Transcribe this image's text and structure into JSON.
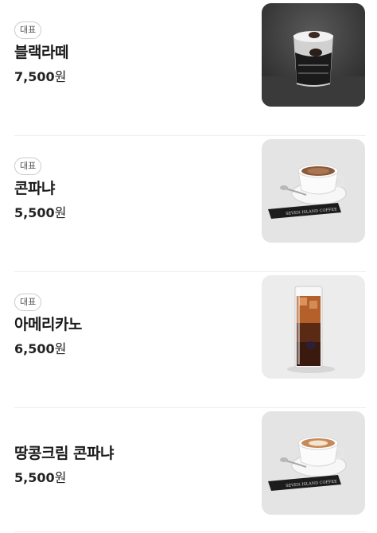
{
  "menu": {
    "items": [
      {
        "badge": "대표",
        "name": "블랙라떼",
        "price": "7,500",
        "currency": "원",
        "image": "black-latte-glass-photo"
      },
      {
        "badge": "대표",
        "name": "콘파냐",
        "price": "5,500",
        "currency": "원",
        "image": "con-panna-cup-photo"
      },
      {
        "badge": "대표",
        "name": "아메리카노",
        "price": "6,500",
        "currency": "원",
        "image": "iced-americano-glass-photo"
      },
      {
        "badge": "",
        "name": "땅콩크림 콘파냐",
        "price": "5,500",
        "currency": "원",
        "image": "peanut-cream-con-panna-cup-photo"
      }
    ],
    "image_text": "SEVEN ISLAND COFFEE"
  }
}
